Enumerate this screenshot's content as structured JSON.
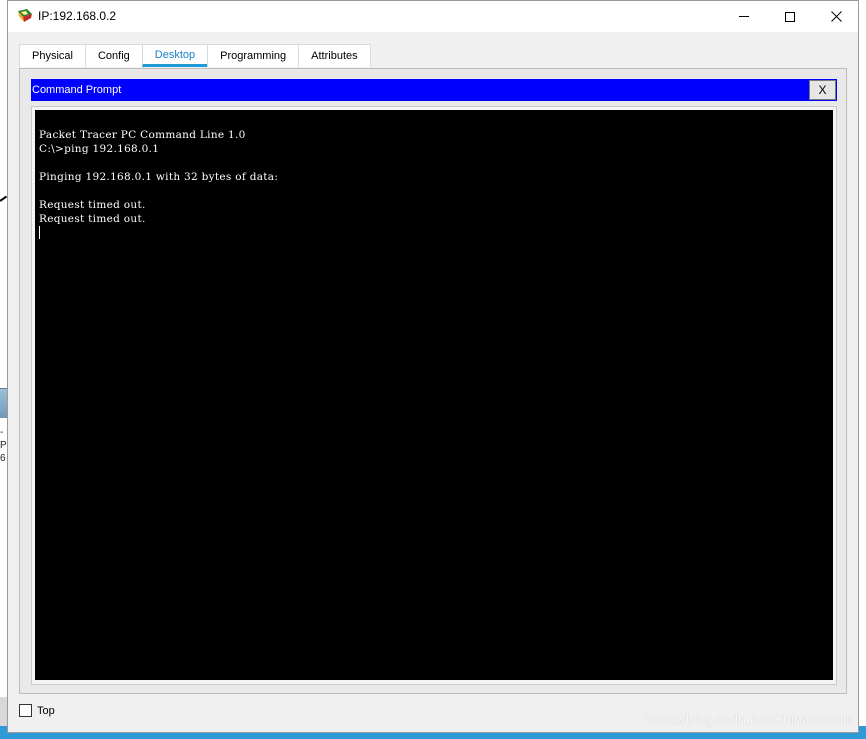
{
  "window": {
    "title": "IP:192.168.0.2",
    "controls": {
      "minimize_icon": "minimize-icon",
      "maximize_icon": "maximize-icon",
      "close_icon": "close-icon"
    }
  },
  "tabs": [
    {
      "label": "Physical",
      "active": false
    },
    {
      "label": "Config",
      "active": false
    },
    {
      "label": "Desktop",
      "active": true
    },
    {
      "label": "Programming",
      "active": false
    },
    {
      "label": "Attributes",
      "active": false
    }
  ],
  "command_prompt": {
    "title": "Command Prompt",
    "close_label": "X",
    "lines": [
      "Packet Tracer PC Command Line 1.0",
      "C:\\>ping 192.168.0.1",
      "",
      "Pinging 192.168.0.1 with 32 bytes of data:",
      "",
      "Request timed out.",
      "Request timed out."
    ]
  },
  "footer": {
    "top_checkbox_label": "Top",
    "top_checked": false
  },
  "background": {
    "sliver_text_line1": "-P",
    "sliver_text_line2": "6"
  },
  "watermark": "https://blog.csdn.net/ChinaNebula",
  "colors": {
    "cmd_titlebar": "#0000ff",
    "terminal_bg": "#000000",
    "active_tab": "#1e9ad6"
  }
}
